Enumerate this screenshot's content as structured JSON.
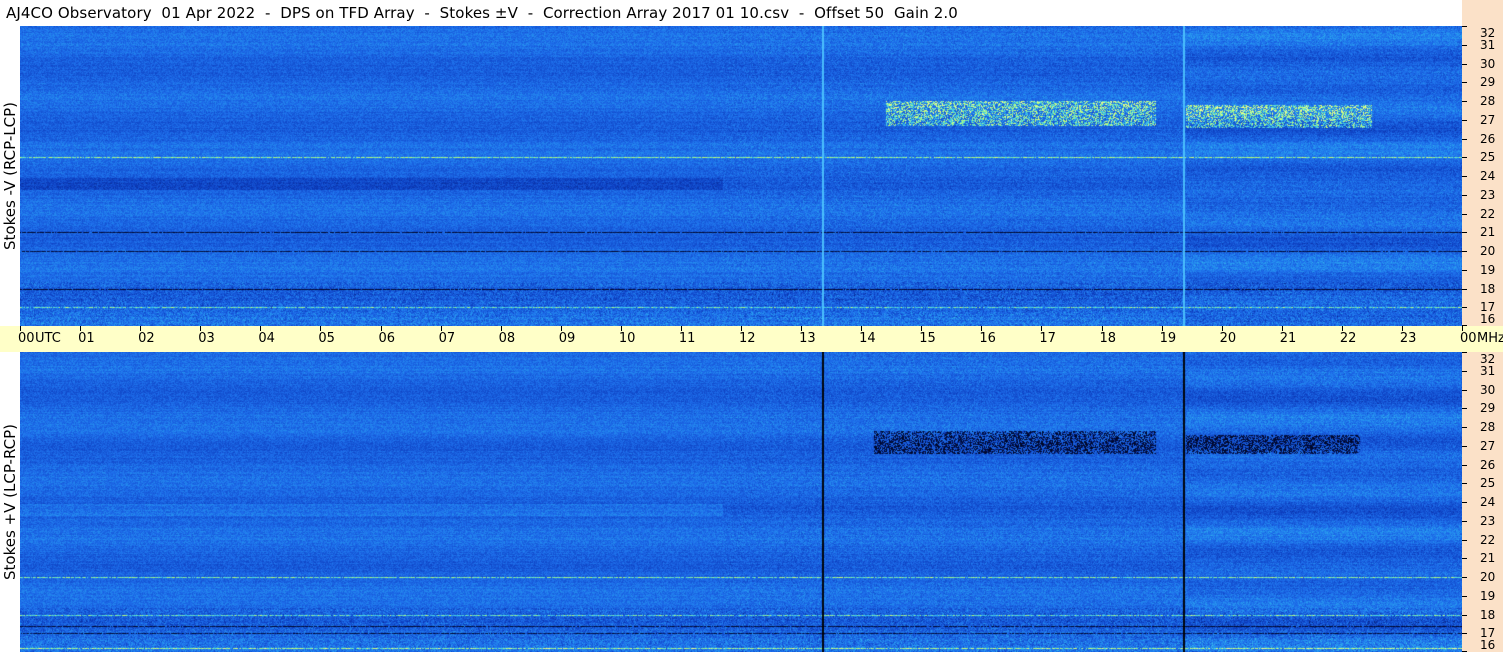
{
  "title": "AJ4CO Observatory  01 Apr 2022  -  DPS on TFD Array  -  Stokes ±V  -  Correction Array 2017 01 10.csv  -  Offset 50  Gain 2.0",
  "panels": {
    "top": {
      "label": "Stokes -V (RCP-LCP)"
    },
    "bottom": {
      "label": "Stokes +V (LCP-RCP)"
    }
  },
  "chart_data": {
    "type": "heatmap",
    "title": "AJ4CO Observatory  01 Apr 2022  -  DPS on TFD Array  -  Stokes ±V  -  Correction Array 2017 01 10.csv  -  Offset 50  Gain 2.0",
    "x_axis": {
      "unit_label": "UTC",
      "range_hours": [
        0,
        24
      ],
      "tick_labels": [
        "00",
        "01",
        "02",
        "03",
        "04",
        "05",
        "06",
        "07",
        "08",
        "09",
        "10",
        "11",
        "12",
        "13",
        "14",
        "15",
        "16",
        "17",
        "18",
        "19",
        "20",
        "21",
        "22",
        "23",
        "00"
      ]
    },
    "y_axis": {
      "unit_label": "MHz",
      "range_mhz": [
        16,
        32
      ],
      "tick_labels": [
        "32",
        "31",
        "30",
        "29",
        "28",
        "27",
        "26",
        "25",
        "24",
        "23",
        "22",
        "21",
        "20",
        "19",
        "18",
        "17",
        "16"
      ]
    },
    "colors": {
      "background": "#1e6fe0",
      "bright": "#b8ff6e",
      "dark": "#001030",
      "axis_bg": "#ffffc8",
      "freq_bg": "#fbe1c8"
    },
    "panels": [
      {
        "name": "Stokes -V (RCP-LCP)",
        "base_intensity": 0.42,
        "background_step_utc": 11.7,
        "vertical_lines_utc": [
          13.35,
          19.35
        ],
        "vertical_line_tone": "bright",
        "bursts": [
          {
            "utc": [
              14.4,
              18.9
            ],
            "mhz": [
              26.7,
              28.0
            ],
            "tone": "bright"
          },
          {
            "utc": [
              19.4,
              22.5
            ],
            "mhz": [
              26.6,
              27.8
            ],
            "tone": "bright"
          }
        ],
        "narrowband_rfi_mhz": [
          20.0,
          17.0,
          18.0,
          25.0,
          21.0
        ],
        "dark_band_mhz": 23.6
      },
      {
        "name": "Stokes +V (LCP-RCP)",
        "base_intensity": 0.42,
        "background_step_utc": 11.7,
        "vertical_lines_utc": [
          13.35,
          19.35
        ],
        "vertical_line_tone": "dark",
        "bursts": [
          {
            "utc": [
              14.2,
              18.9
            ],
            "mhz": [
              26.6,
              27.8
            ],
            "tone": "dark"
          },
          {
            "utc": [
              19.4,
              22.3
            ],
            "mhz": [
              26.6,
              27.6
            ],
            "tone": "dark"
          }
        ],
        "narrowband_rfi_mhz": [
          20.0,
          17.0,
          18.0,
          17.4,
          16.2
        ],
        "bright_band_mhz": 23.6
      }
    ]
  }
}
